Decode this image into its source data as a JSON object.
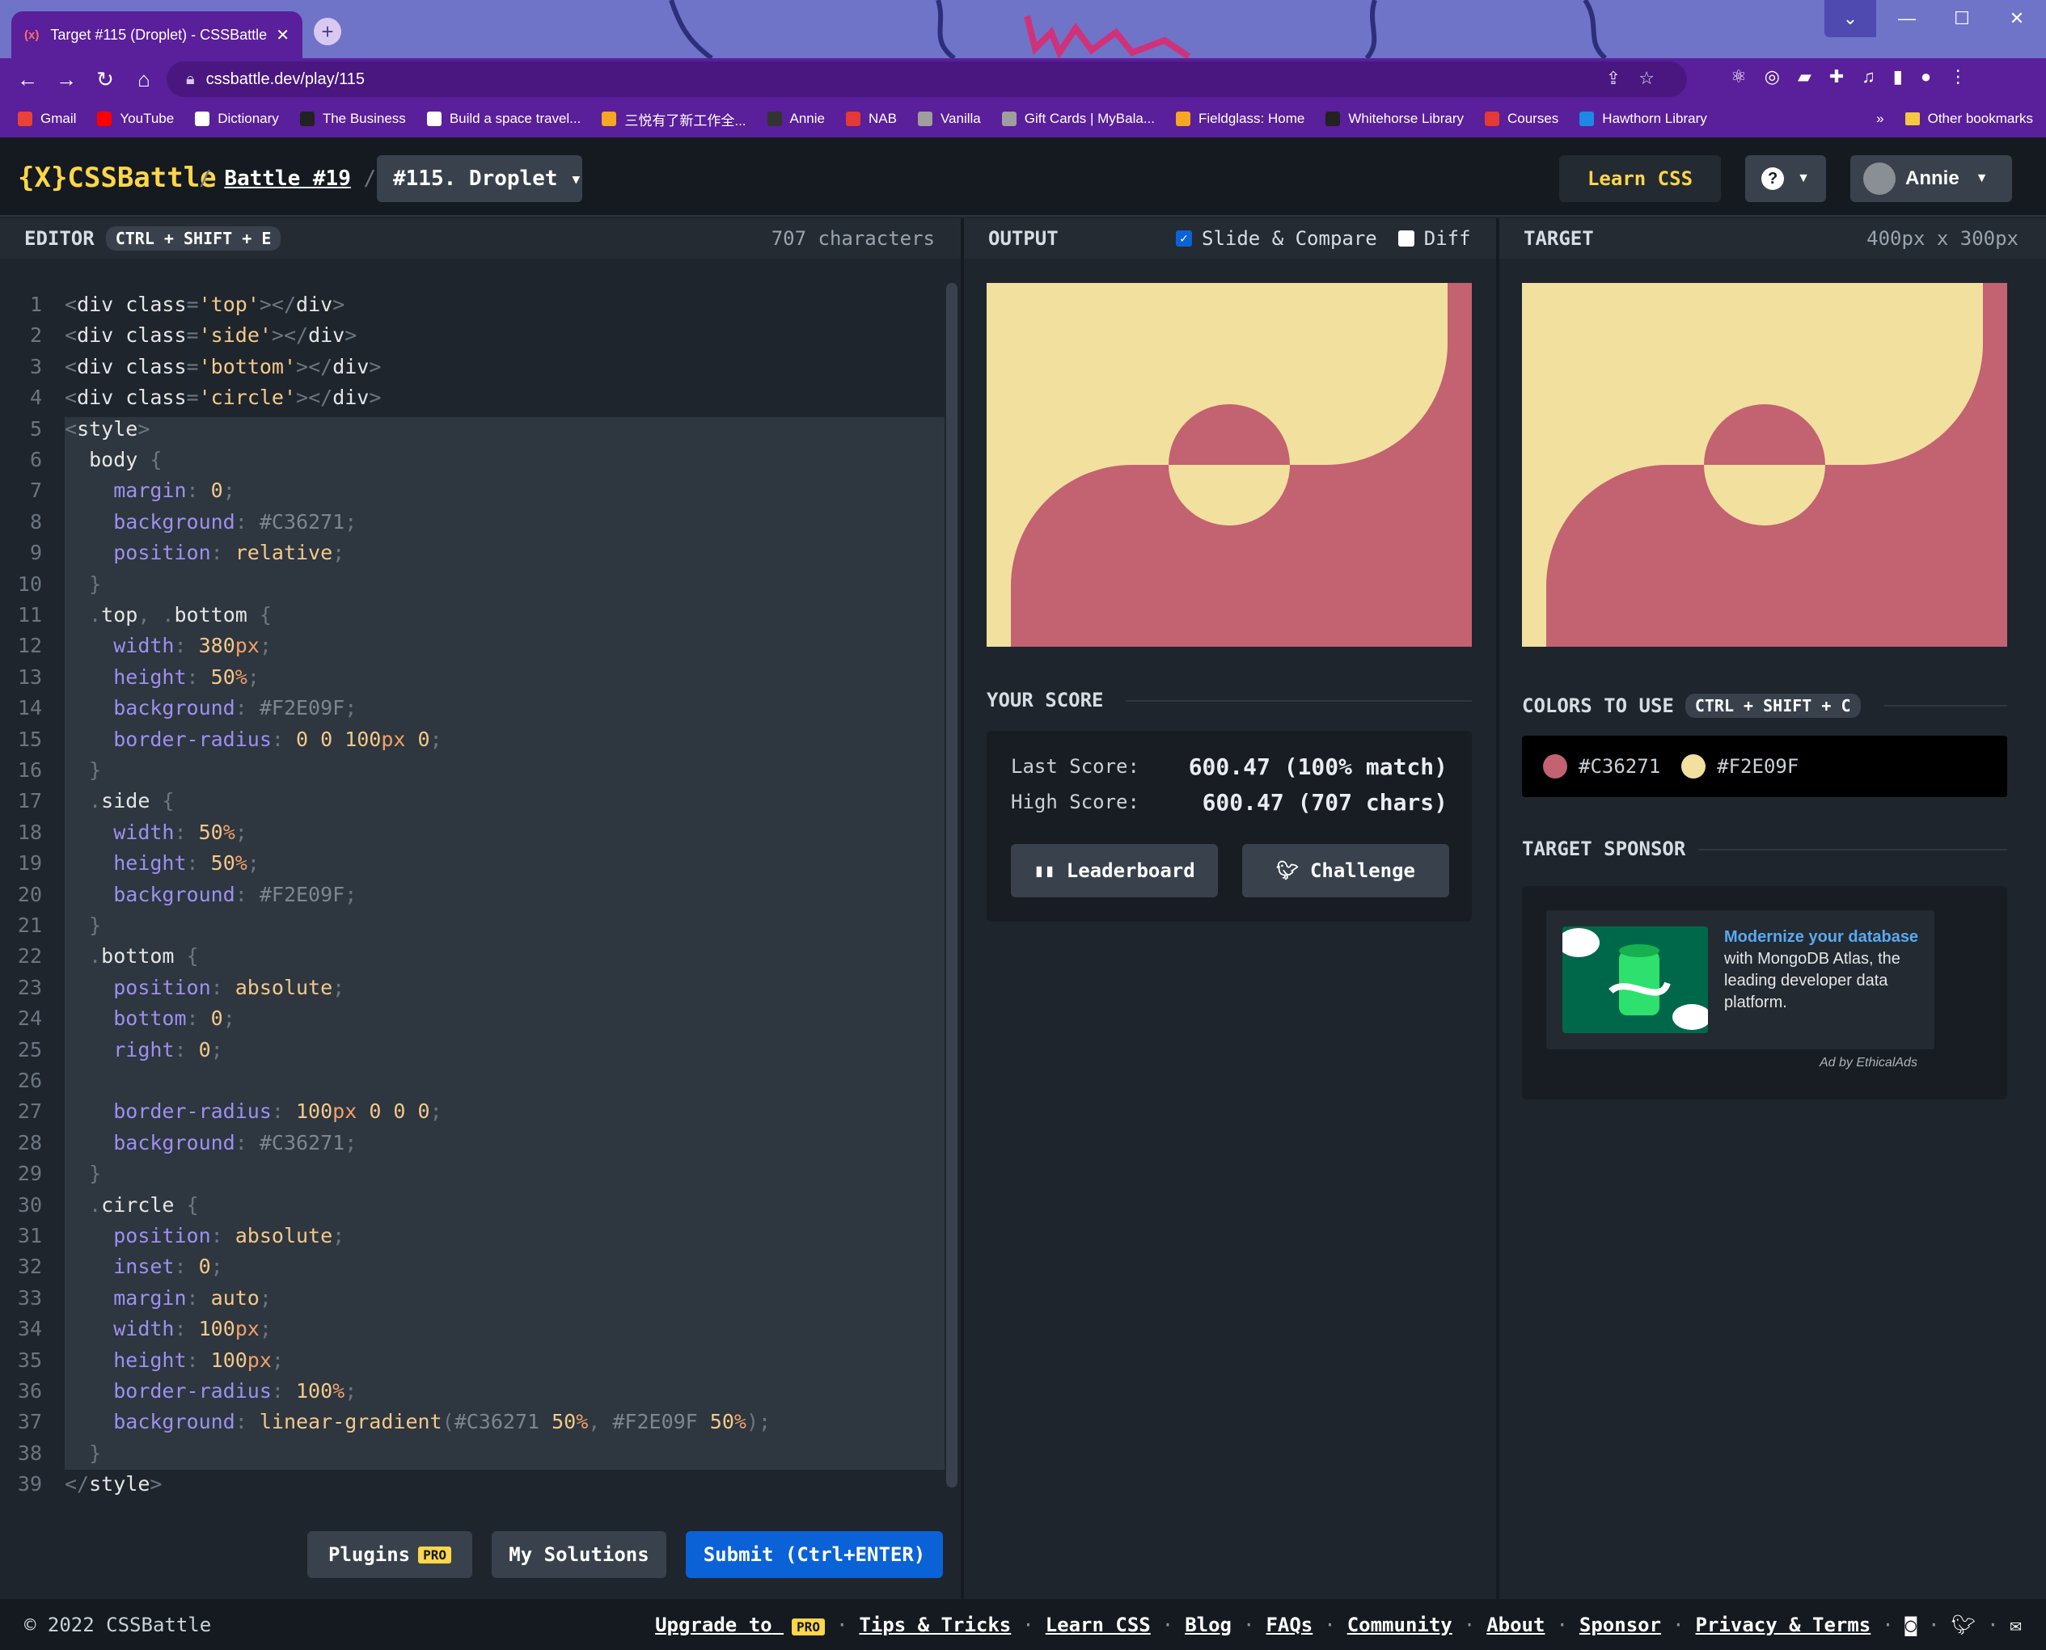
{
  "browser": {
    "tab_title": "Target #115 (Droplet) - CSSBattle",
    "tab_favicon": "(x)",
    "url": "cssbattle.dev/play/115",
    "bookmarks": [
      {
        "label": "Gmail",
        "color": "#ea4335"
      },
      {
        "label": "YouTube",
        "color": "#ff0000"
      },
      {
        "label": "Dictionary",
        "color": "#ffffff"
      },
      {
        "label": "The Business",
        "color": "#222222"
      },
      {
        "label": "Build a space travel...",
        "color": "#ffffff"
      },
      {
        "label": "三悦有了新工作全...",
        "color": "#f5a623"
      },
      {
        "label": "Annie",
        "color": "#333333"
      },
      {
        "label": "NAB",
        "color": "#e53935"
      },
      {
        "label": "Vanilla",
        "color": "#9e9e9e"
      },
      {
        "label": "Gift Cards | MyBala...",
        "color": "#9e9e9e"
      },
      {
        "label": "Fieldglass: Home",
        "color": "#f5a623"
      },
      {
        "label": "Whitehorse Library",
        "color": "#222222"
      },
      {
        "label": "Courses",
        "color": "#e53935"
      },
      {
        "label": "Hawthorn Library",
        "color": "#1e88e5"
      }
    ],
    "bookmarks_more": "»",
    "other_bookmarks": "Other bookmarks"
  },
  "header": {
    "logo": "{X}CSSBattle",
    "sep1": "/",
    "battle": "Battle #19",
    "sep2": "/",
    "target_select": "#115. Droplet",
    "learn_css": "Learn CSS",
    "help": "?",
    "user": "Annie"
  },
  "editor": {
    "title": "EDITOR",
    "shortcut": "CTRL + SHIFT + E",
    "chars": "707 characters",
    "code": [
      [
        [
          "p",
          "<"
        ],
        [
          "tag",
          "div"
        ],
        [
          "t",
          " "
        ],
        [
          "attr",
          "class"
        ],
        [
          "p",
          "="
        ],
        [
          "str",
          "'top'"
        ],
        [
          "p",
          "></"
        ],
        [
          "tag",
          "div"
        ],
        [
          "p",
          ">"
        ]
      ],
      [
        [
          "p",
          "<"
        ],
        [
          "tag",
          "div"
        ],
        [
          "t",
          " "
        ],
        [
          "attr",
          "class"
        ],
        [
          "p",
          "="
        ],
        [
          "str",
          "'side'"
        ],
        [
          "p",
          "></"
        ],
        [
          "tag",
          "div"
        ],
        [
          "p",
          ">"
        ]
      ],
      [
        [
          "p",
          "<"
        ],
        [
          "tag",
          "div"
        ],
        [
          "t",
          " "
        ],
        [
          "attr",
          "class"
        ],
        [
          "p",
          "="
        ],
        [
          "str",
          "'bottom'"
        ],
        [
          "p",
          "></"
        ],
        [
          "tag",
          "div"
        ],
        [
          "p",
          ">"
        ]
      ],
      [
        [
          "p",
          "<"
        ],
        [
          "tag",
          "div"
        ],
        [
          "t",
          " "
        ],
        [
          "attr",
          "class"
        ],
        [
          "p",
          "="
        ],
        [
          "str",
          "'circle'"
        ],
        [
          "p",
          "></"
        ],
        [
          "tag",
          "div"
        ],
        [
          "p",
          ">"
        ]
      ],
      [
        [
          "p",
          "<"
        ],
        [
          "tag",
          "style"
        ],
        [
          "p",
          ">"
        ]
      ],
      [
        [
          "t",
          "  body "
        ],
        [
          "p",
          "{"
        ]
      ],
      [
        [
          "t",
          "    "
        ],
        [
          "prop",
          "margin"
        ],
        [
          "p",
          ": "
        ],
        [
          "num",
          "0"
        ],
        [
          "p",
          ";"
        ]
      ],
      [
        [
          "t",
          "    "
        ],
        [
          "prop",
          "background"
        ],
        [
          "p",
          ": "
        ],
        [
          "col",
          "#C36271"
        ],
        [
          "p",
          ";"
        ]
      ],
      [
        [
          "t",
          "    "
        ],
        [
          "prop",
          "position"
        ],
        [
          "p",
          ": "
        ],
        [
          "kw",
          "relative"
        ],
        [
          "p",
          ";"
        ]
      ],
      [
        [
          "t",
          "  "
        ],
        [
          "p",
          "}"
        ]
      ],
      [
        [
          "t",
          "  "
        ],
        [
          "p",
          "."
        ],
        [
          "t",
          "top"
        ],
        [
          "p",
          ", ."
        ],
        [
          "t",
          "bottom "
        ],
        [
          "p",
          "{"
        ]
      ],
      [
        [
          "t",
          "    "
        ],
        [
          "prop",
          "width"
        ],
        [
          "p",
          ": "
        ],
        [
          "num",
          "380"
        ],
        [
          "unit",
          "px"
        ],
        [
          "p",
          ";"
        ]
      ],
      [
        [
          "t",
          "    "
        ],
        [
          "prop",
          "height"
        ],
        [
          "p",
          ": "
        ],
        [
          "num",
          "50"
        ],
        [
          "unit",
          "%"
        ],
        [
          "p",
          ";"
        ]
      ],
      [
        [
          "t",
          "    "
        ],
        [
          "prop",
          "background"
        ],
        [
          "p",
          ": "
        ],
        [
          "col",
          "#F2E09F"
        ],
        [
          "p",
          ";"
        ]
      ],
      [
        [
          "t",
          "    "
        ],
        [
          "prop",
          "border-radius"
        ],
        [
          "p",
          ": "
        ],
        [
          "num",
          "0 0 100"
        ],
        [
          "unit",
          "px"
        ],
        [
          "num",
          " 0"
        ],
        [
          "p",
          ";"
        ]
      ],
      [
        [
          "t",
          "  "
        ],
        [
          "p",
          "}"
        ]
      ],
      [
        [
          "t",
          "  "
        ],
        [
          "p",
          "."
        ],
        [
          "t",
          "side "
        ],
        [
          "p",
          "{"
        ]
      ],
      [
        [
          "t",
          "    "
        ],
        [
          "prop",
          "width"
        ],
        [
          "p",
          ": "
        ],
        [
          "num",
          "50"
        ],
        [
          "unit",
          "%"
        ],
        [
          "p",
          ";"
        ]
      ],
      [
        [
          "t",
          "    "
        ],
        [
          "prop",
          "height"
        ],
        [
          "p",
          ": "
        ],
        [
          "num",
          "50"
        ],
        [
          "unit",
          "%"
        ],
        [
          "p",
          ";"
        ]
      ],
      [
        [
          "t",
          "    "
        ],
        [
          "prop",
          "background"
        ],
        [
          "p",
          ": "
        ],
        [
          "col",
          "#F2E09F"
        ],
        [
          "p",
          ";"
        ]
      ],
      [
        [
          "t",
          "  "
        ],
        [
          "p",
          "}"
        ]
      ],
      [
        [
          "t",
          "  "
        ],
        [
          "p",
          "."
        ],
        [
          "t",
          "bottom "
        ],
        [
          "p",
          "{"
        ]
      ],
      [
        [
          "t",
          "    "
        ],
        [
          "prop",
          "position"
        ],
        [
          "p",
          ": "
        ],
        [
          "kw",
          "absolute"
        ],
        [
          "p",
          ";"
        ]
      ],
      [
        [
          "t",
          "    "
        ],
        [
          "prop",
          "bottom"
        ],
        [
          "p",
          ": "
        ],
        [
          "num",
          "0"
        ],
        [
          "p",
          ";"
        ]
      ],
      [
        [
          "t",
          "    "
        ],
        [
          "prop",
          "right"
        ],
        [
          "p",
          ": "
        ],
        [
          "num",
          "0"
        ],
        [
          "p",
          ";"
        ]
      ],
      [],
      [
        [
          "t",
          "    "
        ],
        [
          "prop",
          "border-radius"
        ],
        [
          "p",
          ": "
        ],
        [
          "num",
          "100"
        ],
        [
          "unit",
          "px"
        ],
        [
          "num",
          " 0 0 0"
        ],
        [
          "p",
          ";"
        ]
      ],
      [
        [
          "t",
          "    "
        ],
        [
          "prop",
          "background"
        ],
        [
          "p",
          ": "
        ],
        [
          "col",
          "#C36271"
        ],
        [
          "p",
          ";"
        ]
      ],
      [
        [
          "t",
          "  "
        ],
        [
          "p",
          "}"
        ]
      ],
      [
        [
          "t",
          "  "
        ],
        [
          "p",
          "."
        ],
        [
          "t",
          "circle "
        ],
        [
          "p",
          "{"
        ]
      ],
      [
        [
          "t",
          "    "
        ],
        [
          "prop",
          "position"
        ],
        [
          "p",
          ": "
        ],
        [
          "kw",
          "absolute"
        ],
        [
          "p",
          ";"
        ]
      ],
      [
        [
          "t",
          "    "
        ],
        [
          "prop",
          "inset"
        ],
        [
          "p",
          ": "
        ],
        [
          "num",
          "0"
        ],
        [
          "p",
          ";"
        ]
      ],
      [
        [
          "t",
          "    "
        ],
        [
          "prop",
          "margin"
        ],
        [
          "p",
          ": "
        ],
        [
          "kw",
          "auto"
        ],
        [
          "p",
          ";"
        ]
      ],
      [
        [
          "t",
          "    "
        ],
        [
          "prop",
          "width"
        ],
        [
          "p",
          ": "
        ],
        [
          "num",
          "100"
        ],
        [
          "unit",
          "px"
        ],
        [
          "p",
          ";"
        ]
      ],
      [
        [
          "t",
          "    "
        ],
        [
          "prop",
          "height"
        ],
        [
          "p",
          ": "
        ],
        [
          "num",
          "100"
        ],
        [
          "unit",
          "px"
        ],
        [
          "p",
          ";"
        ]
      ],
      [
        [
          "t",
          "    "
        ],
        [
          "prop",
          "border-radius"
        ],
        [
          "p",
          ": "
        ],
        [
          "num",
          "100"
        ],
        [
          "unit",
          "%"
        ],
        [
          "p",
          ";"
        ]
      ],
      [
        [
          "t",
          "    "
        ],
        [
          "prop",
          "background"
        ],
        [
          "p",
          ": "
        ],
        [
          "kw",
          "linear-gradient"
        ],
        [
          "p",
          "("
        ],
        [
          "col",
          "#C36271"
        ],
        [
          "num",
          " 50"
        ],
        [
          "unit",
          "%"
        ],
        [
          "p",
          ", "
        ],
        [
          "col",
          "#F2E09F"
        ],
        [
          "num",
          " 50"
        ],
        [
          "unit",
          "%"
        ],
        [
          "p",
          ");"
        ]
      ],
      [
        [
          "t",
          "  "
        ],
        [
          "p",
          "}"
        ]
      ],
      [
        [
          "p",
          "</"
        ],
        [
          "tag",
          "style"
        ],
        [
          "p",
          ">"
        ]
      ]
    ],
    "plugins": "Plugins",
    "plugins_badge": "PRO",
    "my_solutions": "My Solutions",
    "submit": "Submit (Ctrl+ENTER)"
  },
  "output": {
    "title": "OUTPUT",
    "slide_compare": "Slide & Compare",
    "slide_compare_checked": true,
    "diff": "Diff",
    "diff_checked": false,
    "your_score": "YOUR SCORE",
    "last_score_label": "Last Score:",
    "last_score": "600.47 (100% match)",
    "high_score_label": "High Score:",
    "high_score": "600.47 (707 chars)",
    "leaderboard": "Leaderboard",
    "challenge": "Challenge"
  },
  "target": {
    "title": "TARGET",
    "size": "400px x 300px",
    "colors_title": "COLORS TO USE",
    "colors_shortcut": "CTRL + SHIFT + C",
    "colors": [
      "#C36271",
      "#F2E09F"
    ],
    "sponsor_title": "TARGET SPONSOR",
    "ad_highlight": "Modernize your database",
    "ad_text": " with MongoDB Atlas, the leading developer data platform.",
    "ad_by": "Ad by EthicalAds"
  },
  "footer": {
    "copyright": "© 2022 CSSBattle",
    "upgrade": "Upgrade to",
    "upgrade_badge": "PRO",
    "links": [
      "Tips & Tricks",
      "Learn CSS",
      "Blog",
      "FAQs",
      "Community",
      "About",
      "Sponsor",
      "Privacy & Terms"
    ],
    "sep": "·"
  }
}
